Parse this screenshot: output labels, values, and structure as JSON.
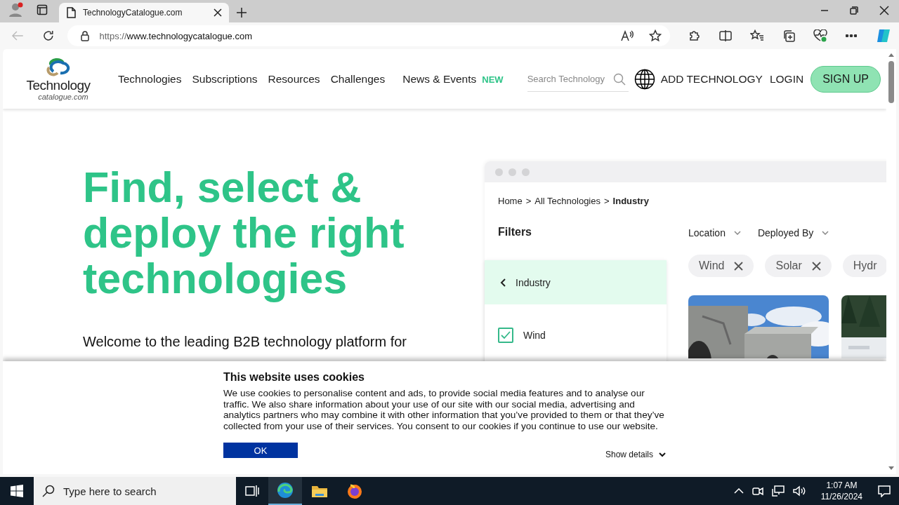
{
  "browser": {
    "tab_title": "TechnologyCatalogue.com",
    "url_scheme": "https://",
    "url_host": "www.technologycatalogue.com"
  },
  "site": {
    "logo_word": "Technology",
    "logo_sub": "catalogue.com",
    "nav": [
      {
        "label": "Technologies"
      },
      {
        "label": "Subscriptions"
      },
      {
        "label": "Resources"
      },
      {
        "label": "Challenges"
      },
      {
        "label": "News & Events",
        "badge": "NEW"
      }
    ],
    "search_placeholder": "Search Technology",
    "add_technology": "ADD TECHNOLOGY",
    "login": "LOGIN",
    "signup": "SIGN UP"
  },
  "hero": {
    "headline": "Find, select & deploy the right technologies",
    "intro": "Welcome to the leading B2B technology platform for"
  },
  "mockup": {
    "breadcrumb": [
      {
        "label": "Home",
        "current": false
      },
      {
        "label": "All Technologies",
        "current": false
      },
      {
        "label": "Industry",
        "current": true
      }
    ],
    "separator": ">",
    "filters_title": "Filters",
    "category": "Industry",
    "options": [
      {
        "label": "Wind",
        "checked": true
      }
    ],
    "dropdowns": [
      "Location",
      "Deployed By"
    ],
    "chips": [
      "Wind",
      "Solar",
      "Hydr"
    ],
    "cards": [
      {
        "kind": "picture"
      },
      {
        "kind": "picture"
      }
    ]
  },
  "cookie": {
    "title": "This website uses cookies",
    "body": "We use cookies to personalise content and ads, to provide social media features and to analyse our traffic. We also share information about your use of our site with our social media, advertising and analytics partners who may combine it with other information that you’ve provided to them or that they’ve collected from your use of their services. You consent to our cookies if you continue to use our website.",
    "ok": "OK",
    "details": "Show details"
  },
  "taskbar": {
    "search_placeholder": "Type here to search",
    "time": "1:07 AM",
    "date": "11/26/2024"
  }
}
